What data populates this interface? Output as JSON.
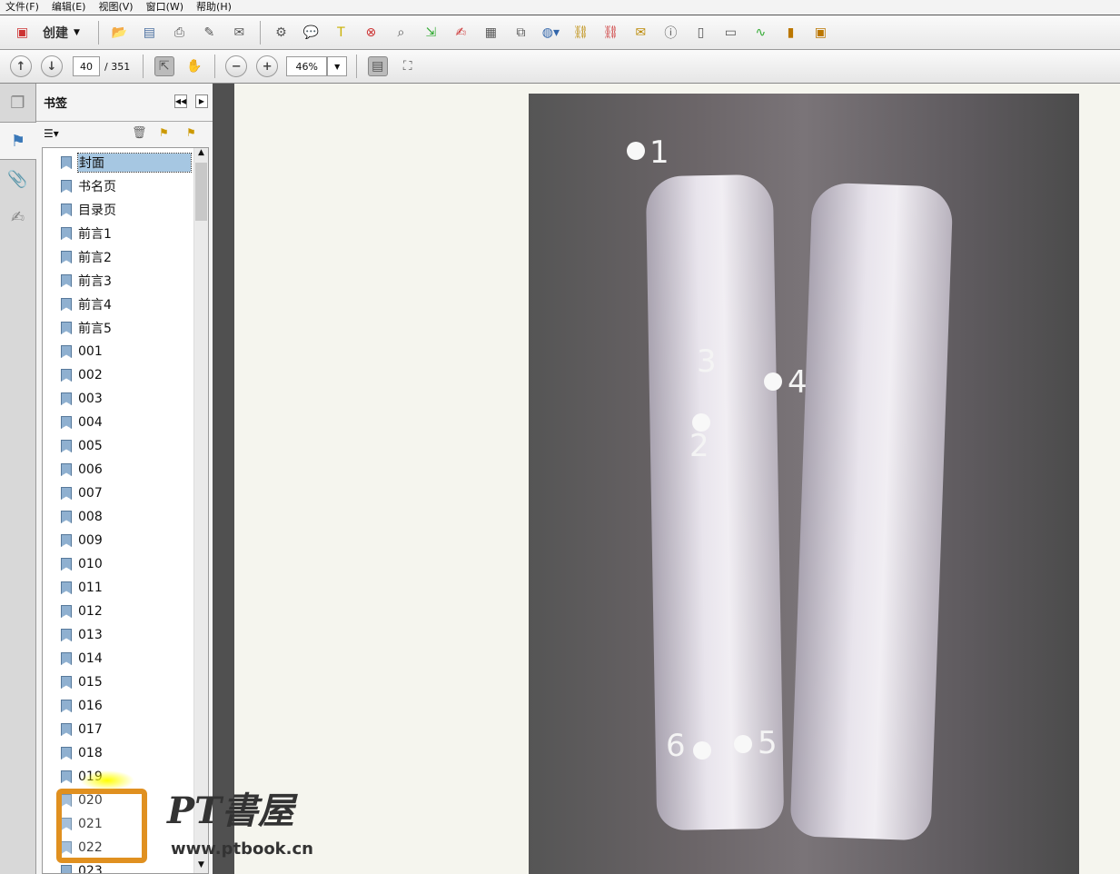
{
  "menu": [
    "文件(F)",
    "编辑(E)",
    "视图(V)",
    "窗口(W)",
    "帮助(H)"
  ],
  "toolbar": {
    "create_label": "创建"
  },
  "nav": {
    "page": "40",
    "total": "/ 351",
    "zoom": "46%"
  },
  "panel": {
    "title": "书签"
  },
  "bookmarks": [
    "封面",
    "书名页",
    "目录页",
    "前言1",
    "前言2",
    "前言3",
    "前言4",
    "前言5",
    "001",
    "002",
    "003",
    "004",
    "005",
    "006",
    "007",
    "008",
    "009",
    "010",
    "011",
    "012",
    "013",
    "014",
    "015",
    "016",
    "017",
    "018",
    "019",
    "020",
    "021",
    "022",
    "023"
  ],
  "figure": {
    "labels": [
      "1",
      "2",
      "3",
      "4",
      "5",
      "6"
    ]
  },
  "watermark": {
    "brand": "PT書屋",
    "url": "www.ptbook.cn"
  }
}
